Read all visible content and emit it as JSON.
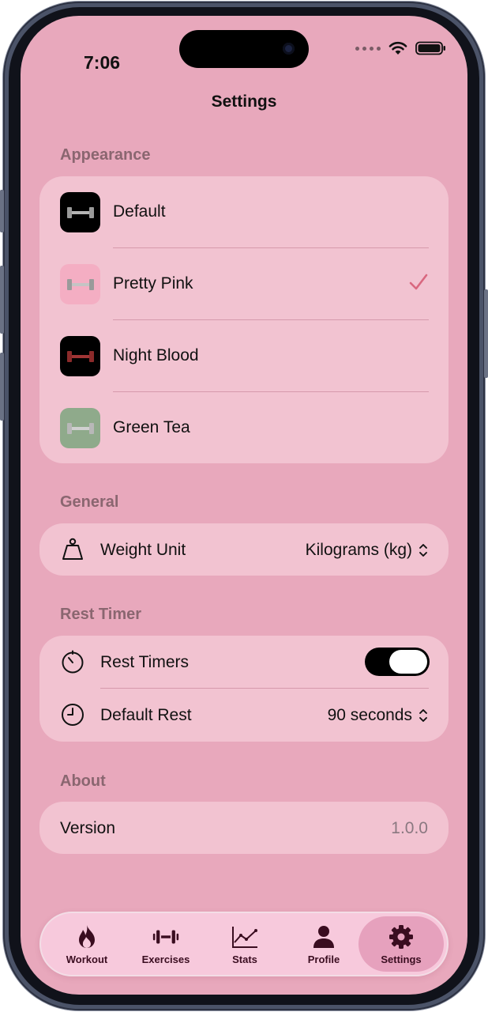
{
  "status_bar": {
    "time": "7:06"
  },
  "nav": {
    "title": "Settings"
  },
  "sections": {
    "appearance": {
      "header": "Appearance",
      "themes": [
        {
          "label": "Default",
          "icon": "dumbbell-icon",
          "icon_bg": "#000000",
          "icon_color": "#9a9a9a",
          "selected": false
        },
        {
          "label": "Pretty Pink",
          "icon": "dumbbell-icon",
          "icon_bg": "#f4aec3",
          "icon_color": "#9a9a9a",
          "selected": true
        },
        {
          "label": "Night Blood",
          "icon": "dumbbell-icon",
          "icon_bg": "#000000",
          "icon_color": "#8b2a2a",
          "selected": false
        },
        {
          "label": "Green Tea",
          "icon": "dumbbell-icon",
          "icon_bg": "#8faa8b",
          "icon_color": "#c8c8c8",
          "selected": false
        }
      ],
      "check_icon": "checkmark-icon",
      "check_color": "#d9677f"
    },
    "general": {
      "header": "General",
      "weight_unit": {
        "label": "Weight Unit",
        "value": "Kilograms (kg)",
        "icon": "weight-icon"
      }
    },
    "rest_timer": {
      "header": "Rest Timer",
      "rest_timers": {
        "label": "Rest Timers",
        "enabled": true,
        "icon": "timer-icon"
      },
      "default_rest": {
        "label": "Default Rest",
        "value": "90 seconds",
        "icon": "clock-icon"
      }
    },
    "about": {
      "header": "About",
      "version": {
        "label": "Version",
        "value": "1.0.0"
      }
    }
  },
  "tabbar": {
    "tabs": [
      {
        "label": "Workout",
        "icon": "flame-icon",
        "active": false
      },
      {
        "label": "Exercises",
        "icon": "dumbbell-icon",
        "active": false
      },
      {
        "label": "Stats",
        "icon": "chart-icon",
        "active": false
      },
      {
        "label": "Profile",
        "icon": "person-icon",
        "active": false
      },
      {
        "label": "Settings",
        "icon": "gear-icon",
        "active": true
      }
    ]
  },
  "colors": {
    "background": "#e8a8bc",
    "card": "#f2c3d1",
    "accent": "#d9677f",
    "tab_icon": "#3a0d20"
  }
}
